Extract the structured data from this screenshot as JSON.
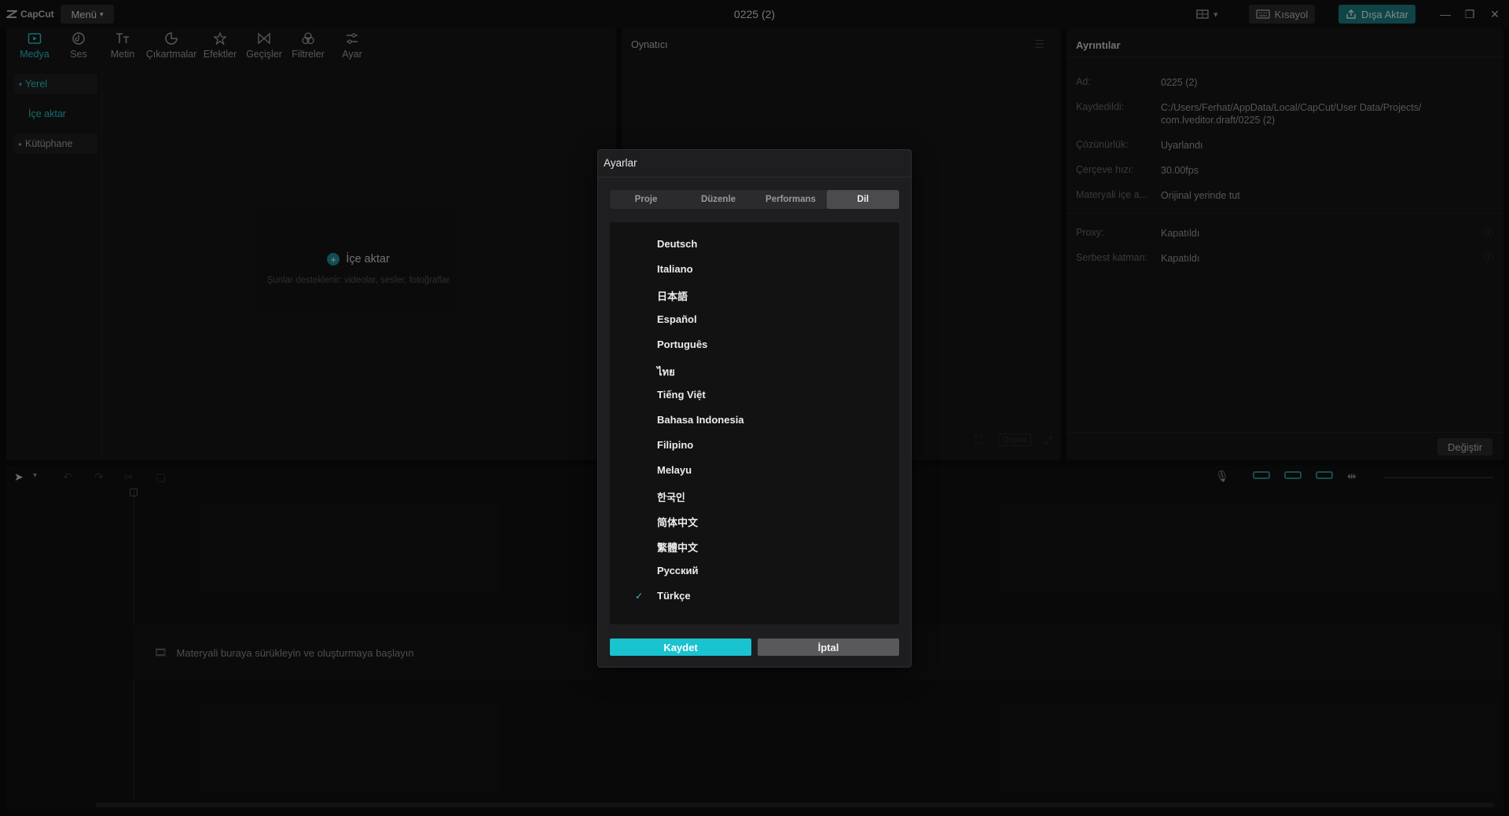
{
  "app": {
    "logo_text": "CapCut",
    "menu_label": "Menü",
    "project_title": "0225 (2)",
    "shortcut_label": "Kısayol",
    "export_label": "Dışa Aktar"
  },
  "toolbar": {
    "items": [
      {
        "label": "Medya",
        "icon": "media-icon"
      },
      {
        "label": "Ses",
        "icon": "audio-icon"
      },
      {
        "label": "Metin",
        "icon": "text-icon"
      },
      {
        "label": "Çıkartmalar",
        "icon": "sticker-icon"
      },
      {
        "label": "Efektler",
        "icon": "effects-icon"
      },
      {
        "label": "Geçişler",
        "icon": "transitions-icon"
      },
      {
        "label": "Filtreler",
        "icon": "filters-icon"
      },
      {
        "label": "Ayar",
        "icon": "adjust-icon"
      }
    ]
  },
  "sidebar": {
    "local": "Yerel",
    "import": "İçe aktar",
    "library": "Kütüphane"
  },
  "media": {
    "import_label": "İçe aktar",
    "supported_text": "Şunlar desteklenir: videolar, sesler, fotoğraflar"
  },
  "player": {
    "title": "Oynatıcı",
    "original_label": "Orijinal"
  },
  "details": {
    "title": "Ayrıntılar",
    "rows": [
      {
        "key": "Ad:",
        "value": "0225 (2)"
      },
      {
        "key": "Kaydedildi:",
        "value": "C:/Users/Ferhat/AppData/Local/CapCut/User Data/Projects/",
        "value2": "com.lveditor.draft/0225 (2)"
      },
      {
        "key": "Çözünürlük:",
        "value": "Uyarlandı"
      },
      {
        "key": "Çerçeve hızı:",
        "value": "30.00fps"
      },
      {
        "key": "Materyali içe a...",
        "value": "Orijinal yerinde tut"
      },
      {
        "key": "Proxy:",
        "value": "Kapatıldı"
      },
      {
        "key": "Serbest katman:",
        "value": "Kapatıldı"
      }
    ],
    "change_label": "Değiştir"
  },
  "timeline": {
    "drop_hint": "Materyali buraya sürükleyin ve oluşturmaya başlayın"
  },
  "dialog": {
    "title": "Ayarlar",
    "tabs": [
      "Proje",
      "Düzenle",
      "Performans",
      "Dil"
    ],
    "active_tab": 3,
    "languages": [
      "Deutsch",
      "Italiano",
      "日本語",
      "Español",
      "Português",
      "ไทย",
      "Tiếng Việt",
      "Bahasa Indonesia",
      "Filipino",
      "Melayu",
      "한국인",
      "简体中文",
      "繁體中文",
      "Русский",
      "Türkçe"
    ],
    "selected_language": "Türkçe",
    "save_label": "Kaydet",
    "cancel_label": "İptal"
  },
  "colors": {
    "accent": "#19c3cf",
    "export_bg": "#1c7e82",
    "panel": "#161617"
  }
}
